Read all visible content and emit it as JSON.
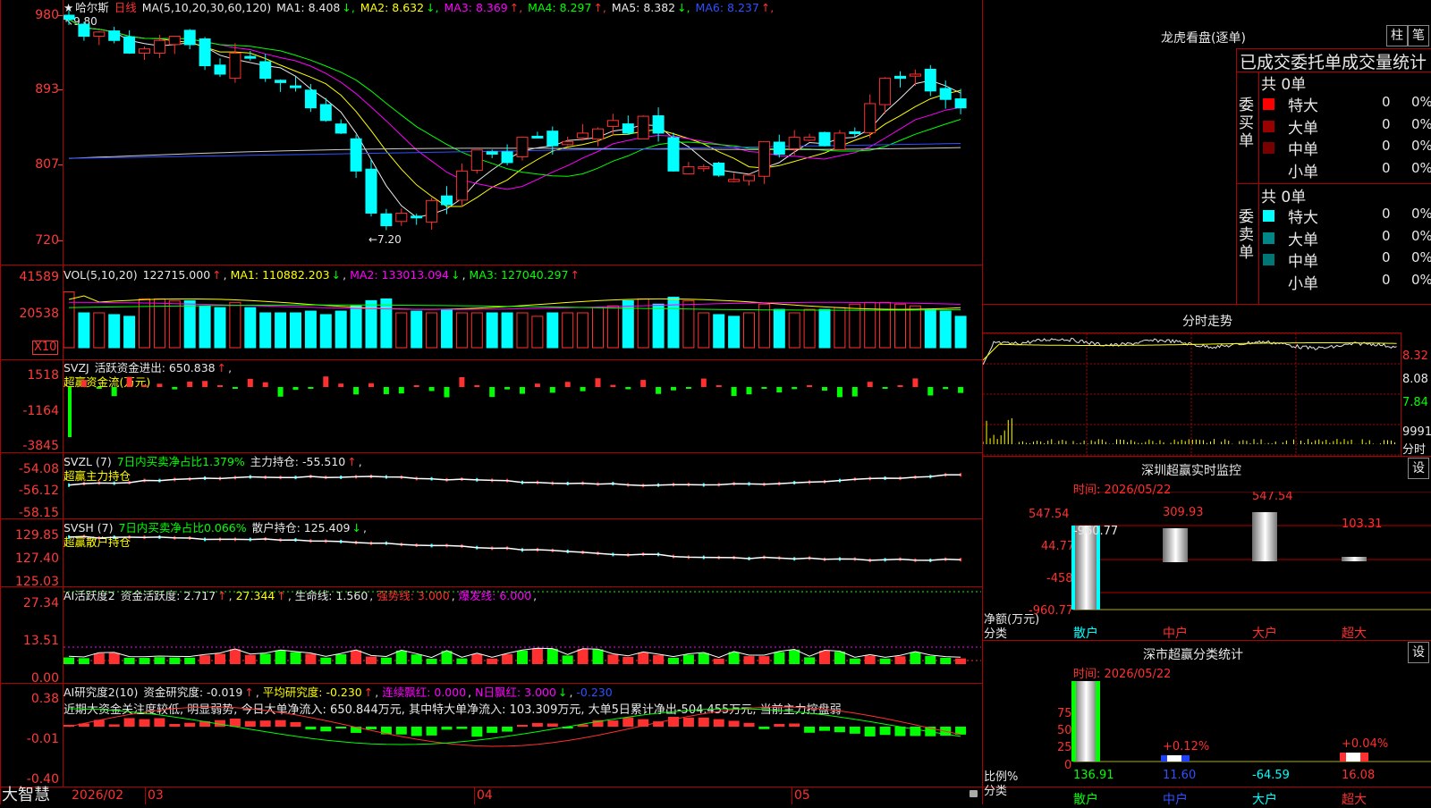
{
  "main": {
    "stock": "哈尔斯",
    "star": "★",
    "period": "日线",
    "ma_label": "MA(5,10,20,30,60,120)",
    "ma": [
      {
        "name": "MA1:",
        "value": "8.408",
        "arrow": "↓",
        "color": "#e8e8e8"
      },
      {
        "name": "MA2:",
        "value": "8.632",
        "arrow": "↓",
        "color": "#ffff00"
      },
      {
        "name": "MA3:",
        "value": "8.369",
        "arrow": "↑",
        "color": "#ff00ff"
      },
      {
        "name": "MA4:",
        "value": "8.297",
        "arrow": "↑",
        "color": "#00ff00"
      },
      {
        "name": "MA5:",
        "value": "8.382",
        "arrow": "↓",
        "color": "#e8e8e8"
      },
      {
        "name": "MA6:",
        "value": "8.237",
        "arrow": "↑",
        "color": "#3050ff"
      }
    ],
    "high_mark": "9.80",
    "low_mark": "←7.20",
    "y_labels": [
      "980",
      "893",
      "807",
      "720"
    ]
  },
  "vol": {
    "label": "VOL(5,10,20)",
    "value": "122715.000",
    "ma1": "MA1: 110882.203",
    "ma2": "MA2: 133013.094",
    "ma3": "MA3: 127040.297",
    "y_labels": [
      "41589",
      "20538"
    ],
    "unit": "X10"
  },
  "svzj": {
    "label": "SVZJ",
    "title": "活跃资金进出: 650.838",
    "subtitle": "超赢资金流(万元)",
    "y_labels": [
      "1518",
      "-1164",
      "-3845"
    ]
  },
  "svzl": {
    "label": "SVZL (7)",
    "ratio": "7日内买卖净占比1.379%",
    "hold": "主力持仓: -55.510",
    "subtitle": "超赢主力持仓",
    "y_labels": [
      "-54.08",
      "-56.12",
      "-58.15"
    ]
  },
  "svsh": {
    "label": "SVSH (7)",
    "ratio": "7日内买卖净占比0.066%",
    "hold": "散户持仓: 125.409",
    "subtitle": "超赢散户持仓",
    "y_labels": [
      "129.85",
      "127.40",
      "125.03"
    ]
  },
  "ai1": {
    "label": "AI活跃度2",
    "act": "资金活跃度: 2.717",
    "v2": "27.344",
    "life": "生命线: 1.560",
    "strong": "强势线: 3.000",
    "burst": "爆发线: 6.000",
    "y_labels": [
      "27.34",
      "13.51",
      "0.00"
    ]
  },
  "ai2": {
    "label": "AI研究度2(10)",
    "res": "资金研究度: -0.019",
    "avg": "平均研究度: -0.230",
    "cont": "连续飘红: 0.000",
    "nday": "N日飘红: 3.000",
    "tail": "-0.230",
    "note": "近期大资金关注度较低, 明显弱势, 今日大单净流入: 650.844万元, 其中特大单净流入: 103.309万元, 大单5日累计净出-504.455万元, 当前主力控盘弱",
    "y_labels": [
      "0.38",
      "-0.01",
      "-0.40"
    ]
  },
  "footer": {
    "brand": "大智慧",
    "dates": [
      "2026/02",
      "03",
      "04",
      "05"
    ]
  },
  "right": {
    "lh_title": "龙虎看盘(逐单)",
    "tab_bar": "柱",
    "tab_pen": "笔",
    "stats_title": "已成交委托单成交量统计",
    "buy_side": "委买单",
    "sell_side": "委卖单",
    "buy_total": "共 0单",
    "sell_total": "共 0单",
    "buy_rows": [
      {
        "name": "特大",
        "count": "0",
        "pct": "0%",
        "color": "#ff0000"
      },
      {
        "name": "大单",
        "count": "0",
        "pct": "0%",
        "color": "#990000"
      },
      {
        "name": "中单",
        "count": "0",
        "pct": "0%",
        "color": "#770000"
      },
      {
        "name": "小单",
        "count": "0",
        "pct": "0%",
        "color": ""
      }
    ],
    "sell_rows": [
      {
        "name": "特大",
        "count": "0",
        "pct": "0%",
        "color": "#00ffff"
      },
      {
        "name": "大单",
        "count": "0",
        "pct": "0%",
        "color": "#008888"
      },
      {
        "name": "中单",
        "count": "0",
        "pct": "0%",
        "color": "#007777"
      },
      {
        "name": "小单",
        "count": "0",
        "pct": "0%",
        "color": ""
      }
    ],
    "intraday_title": "分时走势",
    "intraday_y": [
      "8.32",
      "8.08",
      "7.84"
    ],
    "intraday_vol": "9991",
    "intraday_unit": "分时",
    "sz_title": "深圳超赢实时监控",
    "set1": "设",
    "sz_time": "时间: 2026/05/22",
    "sz_y": [
      "547.54",
      "44.77",
      "-458",
      "-960.77"
    ],
    "sz_vals": [
      "-960.77",
      "309.93",
      "547.54",
      "103.31"
    ],
    "sz_unit1": "净额(万元)",
    "sz_unit2": "分类",
    "sz_cats": [
      "散户",
      "中户",
      "大户",
      "超大"
    ],
    "cls_title": "深市超赢分类统计",
    "set2": "设",
    "cls_time": "时间: 2026/05/22",
    "cls_y": [
      "75",
      "50",
      "25",
      "0"
    ],
    "cls_vals": [
      "136.91",
      "11.60",
      "-64.59",
      "16.08"
    ],
    "cls_pcts": [
      "+0.12%",
      "+0.04%"
    ],
    "cls_unit1": "比例%",
    "cls_unit2": "分类",
    "cls_cats": [
      "散户",
      "中户",
      "大户",
      "超大"
    ]
  }
}
